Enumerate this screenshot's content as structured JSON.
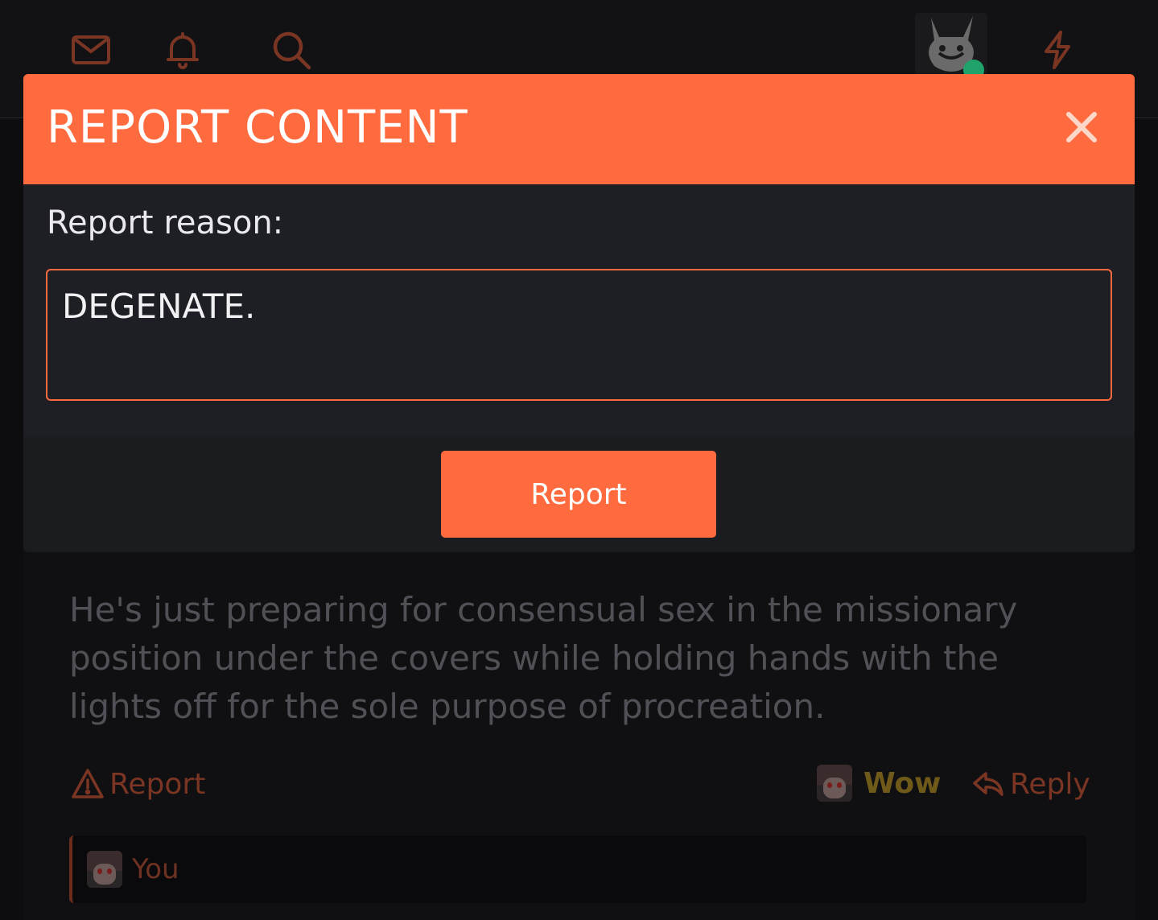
{
  "modal": {
    "title": "REPORT CONTENT",
    "reason_label": "Report reason:",
    "reason_value": "DEGENATE.",
    "submit_label": "Report"
  },
  "post": {
    "text": "He's just preparing for consensual sex in the missionary position under the covers while holding hands with the lights off for the sole purpose of procreation.",
    "report_label": "Report",
    "reaction_label": "Wow",
    "reply_label": "Reply",
    "reacted_by": "You"
  },
  "icons": {
    "inbox": "envelope-icon",
    "alerts": "bell-icon",
    "search": "search-icon",
    "whats_new": "lightning-icon",
    "close": "close-icon",
    "report": "warning-icon",
    "reply": "reply-icon"
  },
  "colors": {
    "accent": "#ff6a3f",
    "modal_bg": "#1e1f24",
    "page_bg": "#0d0d10"
  }
}
